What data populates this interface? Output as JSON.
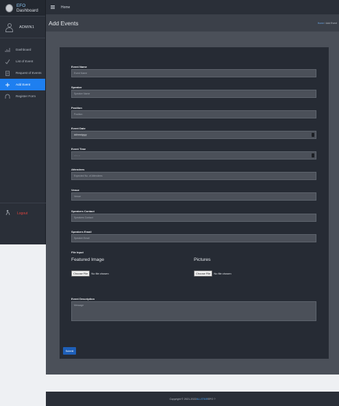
{
  "brand": {
    "prefix": "EFO",
    "suffix": " Dashboard"
  },
  "user": {
    "name": "ADMIN1"
  },
  "sidebar": {
    "items": [
      {
        "label": "Dashboard",
        "icon": "chart-icon"
      },
      {
        "label": "List of Event",
        "icon": "check-icon"
      },
      {
        "label": "Request of Events",
        "icon": "clipboard-icon"
      },
      {
        "label": "Add Event",
        "icon": "plus-icon"
      },
      {
        "label": "Register Form",
        "icon": "arc-icon"
      }
    ],
    "logout": "Logout"
  },
  "topbar": {
    "home": "Home"
  },
  "page": {
    "title": "Add Events",
    "breadcrumb_home": "Home",
    "breadcrumb_sep": " / ",
    "breadcrumb_current": "Add Event"
  },
  "form": {
    "event_name": {
      "label": "Event Name",
      "placeholder": "Event Name"
    },
    "speaker": {
      "label": "Speaker",
      "placeholder": "Speaker Name"
    },
    "position": {
      "label": "Position",
      "placeholder": "Position"
    },
    "event_date": {
      "label": "Event Date",
      "value": "dd/mm/yyyy"
    },
    "event_time": {
      "label": "Event Time",
      "value": "--:-- --"
    },
    "attendees": {
      "label": "Attendees",
      "placeholder": "Expected No. of Attendees"
    },
    "venue": {
      "label": "Venue",
      "placeholder": "Venue"
    },
    "speakers_contact": {
      "label": "Speakers Contact",
      "placeholder": "Speakers Contact"
    },
    "speakers_email": {
      "label": "Speakers Email",
      "placeholder": "Speaker Email"
    },
    "file_input": {
      "label": "File Input",
      "featured_heading": "Featured Image",
      "pictures_heading": "Pictures",
      "choose_label": "Choose File",
      "no_file": "No file chosen"
    },
    "description": {
      "label": "Event Description",
      "placeholder": "Message"
    },
    "submit": "Submit"
  },
  "footer": {
    "prefix": "Copyright © 2021-2022 ",
    "link": "ALLSTAR",
    "suffix": " EFO ?"
  }
}
